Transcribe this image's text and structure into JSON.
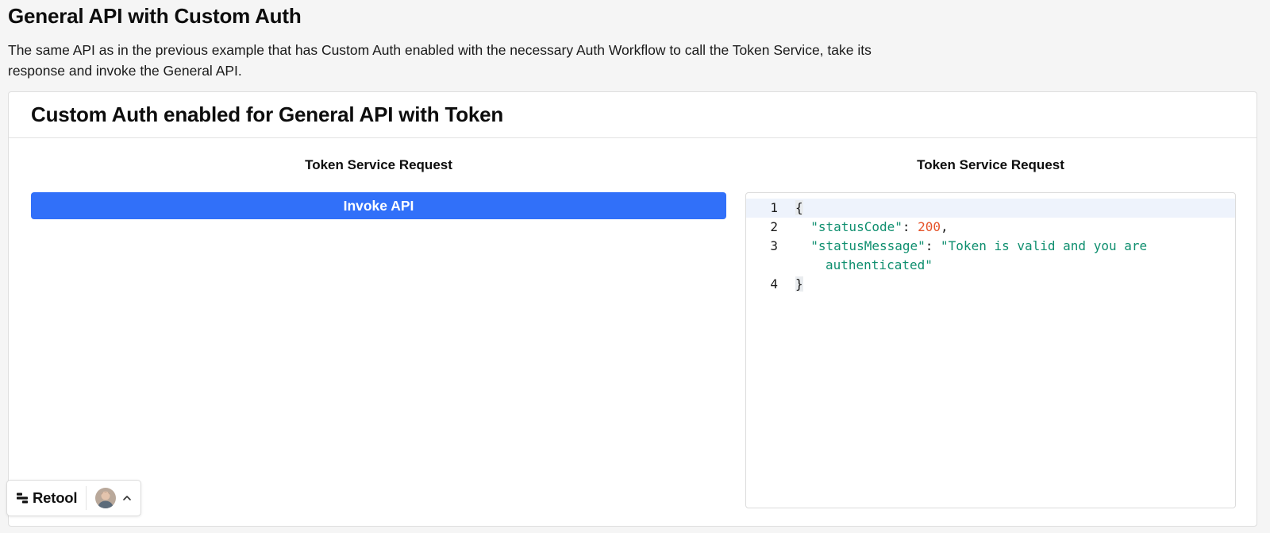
{
  "page": {
    "title": "General API with Custom Auth",
    "description": "The same API as in the previous example that has Custom Auth enabled with the necessary Auth Workflow to call the Token Service, take its response and invoke the General API."
  },
  "card": {
    "title": "Custom Auth enabled for General API with Token",
    "left_column_label": "Token Service Request",
    "right_column_label": "Token Service Request",
    "invoke_button_label": "Invoke API"
  },
  "code": {
    "line_numbers": [
      "1",
      "2",
      "3",
      "4"
    ],
    "open_brace": "{",
    "status_code_key": "\"statusCode\"",
    "status_code_value": "200",
    "status_message_key": "\"statusMessage\"",
    "status_message_value_part1": "\"Token is valid and you are",
    "status_message_value_part2": "authenticated\"",
    "close_brace": "}",
    "colon": ": ",
    "comma": ","
  },
  "badge": {
    "brand": "Retool",
    "icons": [
      "retool-logo-icon",
      "avatar",
      "chevron-up-icon"
    ]
  },
  "colors": {
    "accent": "#3170f9",
    "json_key": "#0f8f6f",
    "json_number": "#e5532a",
    "json_string": "#0f8f6f"
  }
}
